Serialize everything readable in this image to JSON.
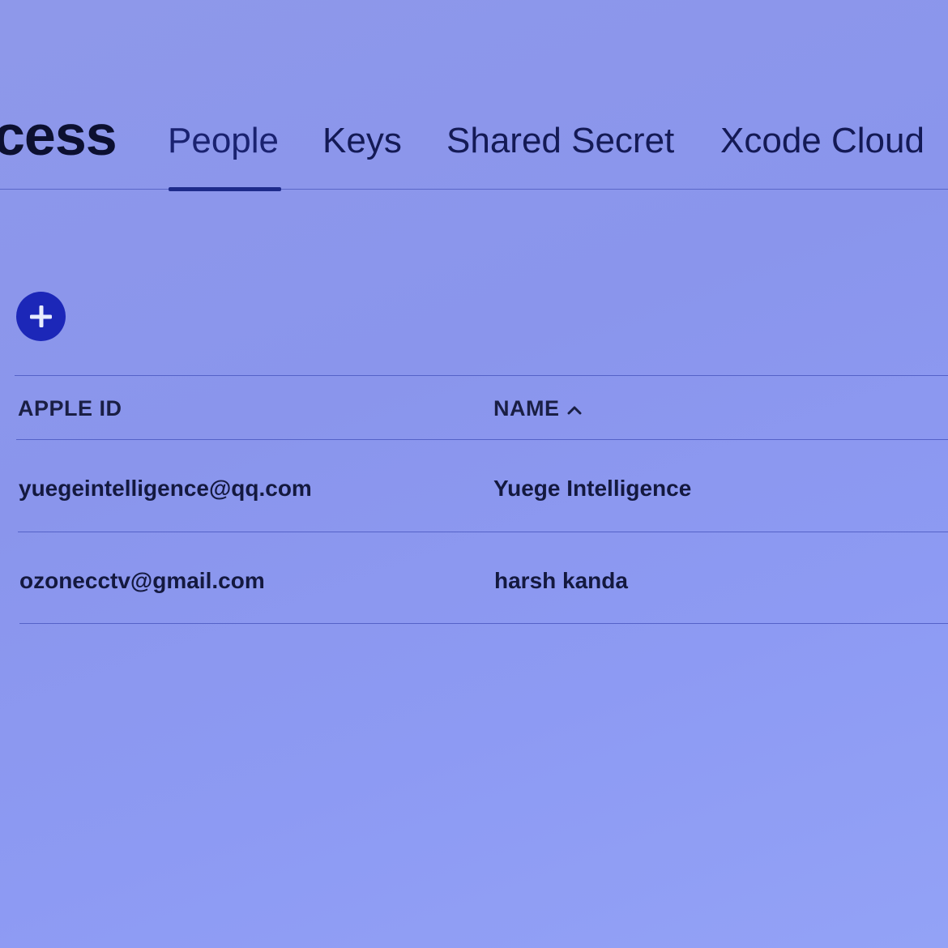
{
  "header": {
    "title_fragment": "cess",
    "tabs": [
      {
        "label": "People",
        "active": true
      },
      {
        "label": "Keys",
        "active": false
      },
      {
        "label": "Shared Secret",
        "active": false
      },
      {
        "label": "Xcode Cloud",
        "active": false
      }
    ]
  },
  "toolbar": {
    "add_icon": "plus-circle-icon"
  },
  "table": {
    "columns": [
      "APPLE ID",
      "NAME"
    ],
    "sort": {
      "column": "NAME",
      "direction": "ascending",
      "icon": "chevron-up-icon"
    },
    "rows": [
      {
        "apple_id": "yuegeintelligence@qq.com",
        "name": "Yuege Intelligence"
      },
      {
        "apple_id": "ozonecctv@gmail.com",
        "name": "harsh kanda"
      }
    ]
  },
  "colors": {
    "background": "#8e98ea",
    "accent": "#1c27b8",
    "active_tab_underline": "#1d2a8a"
  }
}
